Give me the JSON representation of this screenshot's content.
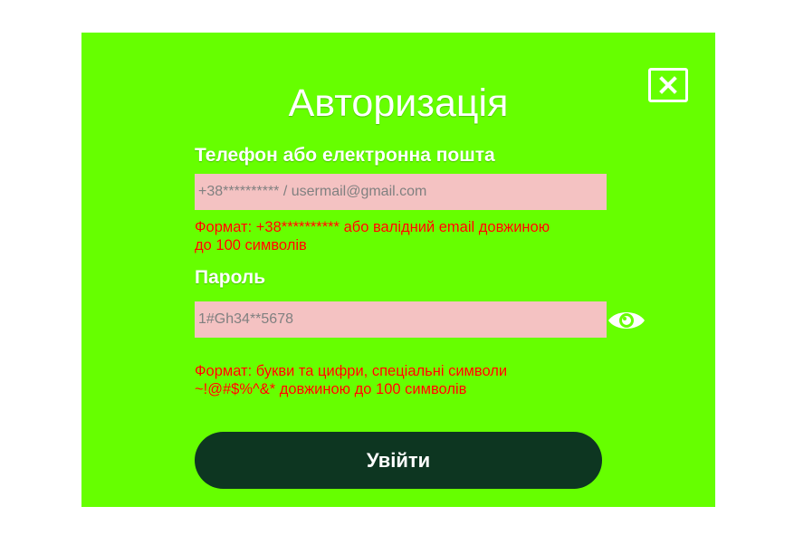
{
  "modal": {
    "title": "Авторизація",
    "close_icon": "close-icon",
    "background_color": "#66ff00"
  },
  "login": {
    "label": "Телефон або електронна пошта",
    "placeholder": "+38********** / usermail@gmail.com",
    "value": "",
    "hint_line1": "Формат: +38********** або валідний email довжиною",
    "hint_line2": "до 100 символів"
  },
  "password": {
    "label": "Пароль",
    "placeholder": "1#Gh34**5678",
    "value": "",
    "toggle_icon": "eye-icon",
    "hint_line1": "Формат: букви та цифри, спеціальні символи",
    "hint_line2": "~!@#$%^&* довжиною до 100 символів"
  },
  "submit": {
    "label": "Увійти",
    "color": "#0d3621"
  },
  "colors": {
    "input_background": "#f4c2c2",
    "hint_text": "#ff0000"
  }
}
